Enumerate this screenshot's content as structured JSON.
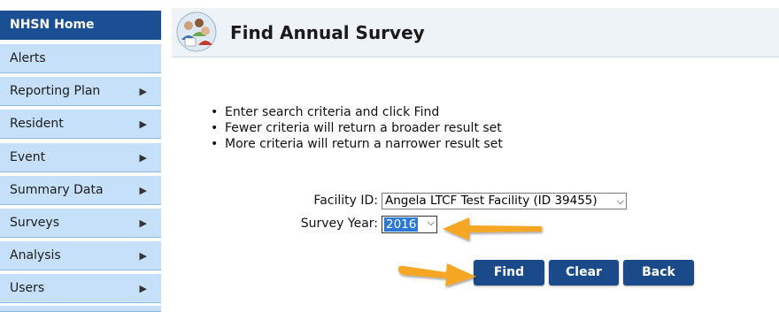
{
  "sidebar": {
    "items": [
      {
        "label": "NHSN Home",
        "submenu": false
      },
      {
        "label": "Alerts",
        "submenu": false
      },
      {
        "label": "Reporting Plan",
        "submenu": true
      },
      {
        "label": "Resident",
        "submenu": true
      },
      {
        "label": "Event",
        "submenu": true
      },
      {
        "label": "Summary Data",
        "submenu": true
      },
      {
        "label": "Surveys",
        "submenu": true
      },
      {
        "label": "Analysis",
        "submenu": true
      },
      {
        "label": "Users",
        "submenu": true
      }
    ],
    "submenu_glyph": "▶"
  },
  "header": {
    "title": "Find Annual Survey",
    "icon": "people-group-icon"
  },
  "instructions": [
    "Enter search criteria and click Find",
    "Fewer criteria will return a broader result set",
    "More criteria will return a narrower result set"
  ],
  "form": {
    "facility_label": "Facility ID:",
    "facility_value": "Angela LTCF Test Facility (ID 39455)",
    "year_label": "Survey Year:",
    "year_value": "2016"
  },
  "buttons": {
    "find": "Find",
    "clear": "Clear",
    "back": "Back"
  },
  "colors": {
    "nav_home_bg": "#1a4f94",
    "nav_item_bg": "#c5e0f8",
    "button_bg": "#1b4a8a",
    "annotation_arrow": "#f5a623",
    "selection_highlight": "#2b78d6"
  }
}
